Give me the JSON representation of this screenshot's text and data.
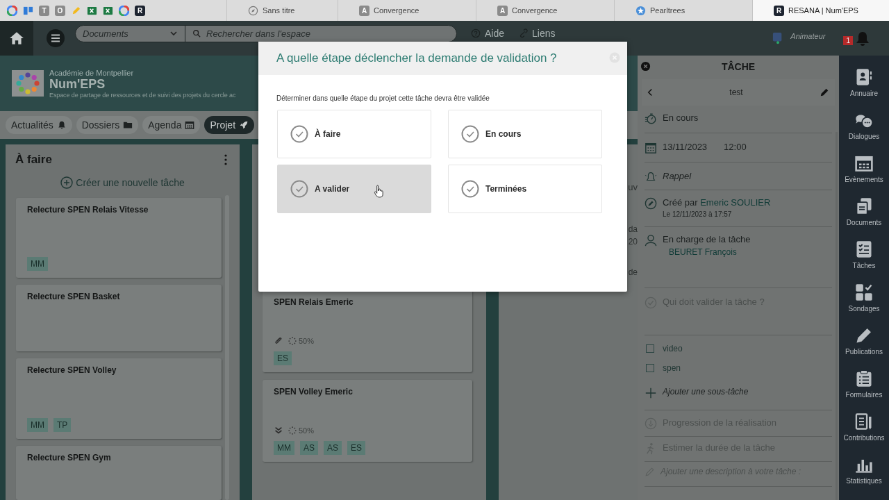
{
  "browser": {
    "shortcuts": [
      {
        "kind": "google"
      },
      {
        "kind": "board"
      },
      {
        "kind": "letter",
        "letter": "T"
      },
      {
        "kind": "letter",
        "letter": "O"
      },
      {
        "kind": "pencil"
      },
      {
        "kind": "sheet"
      },
      {
        "kind": "sheet"
      },
      {
        "kind": "google"
      },
      {
        "kind": "dark-letter",
        "letter": "R"
      }
    ],
    "tabs": [
      {
        "title": "Sans titre",
        "kind": "compass",
        "selected": false
      },
      {
        "title": "Convergence",
        "kind": "letter",
        "letter": "A",
        "selected": false
      },
      {
        "title": "Convergence",
        "kind": "letter",
        "letter": "A",
        "selected": false
      },
      {
        "title": "Pearltrees",
        "kind": "star",
        "selected": false
      },
      {
        "title": "RESANA | Num'EPS",
        "kind": "dark-letter",
        "letter": "R",
        "selected": true
      }
    ]
  },
  "toolbar": {
    "space_select": "Documents",
    "search": {
      "placeholder": "Rechercher dans l'espace"
    },
    "links": [
      {
        "label": "Aide",
        "kind": "help"
      },
      {
        "label": "Liens",
        "kind": "link"
      }
    ],
    "role": "Animateur",
    "notifications": "1"
  },
  "space": {
    "academy": "Académie de Montpellier",
    "name": "Num'EPS",
    "description": "Espace de partage de ressources et de suivi des projets du cercle ac"
  },
  "nav": [
    {
      "label": "Actualités",
      "kind": "bell",
      "selected": false
    },
    {
      "label": "Dossiers",
      "kind": "folder",
      "selected": false
    },
    {
      "label": "Agenda",
      "kind": "calendar",
      "selected": false
    },
    {
      "label": "Projet",
      "kind": "rocket",
      "selected": true
    }
  ],
  "board": {
    "columns": [
      {
        "title": "À faire",
        "create_label": "Créer une nouvelle tâche",
        "cards": [
          {
            "title": "Relecture SPEN Relais Vitesse",
            "tags": [
              "MM"
            ]
          },
          {
            "title": "Relecture SPEN Basket"
          },
          {
            "title": "Relecture SPEN Volley",
            "tags": [
              "MM",
              "TP"
            ]
          },
          {
            "title": "Relecture SPEN Gym"
          }
        ]
      },
      {
        "cards": [
          {
            "title": "SPEN Relais Emeric",
            "kind": "attachment",
            "progress": "50%",
            "tags": [
              "ES"
            ]
          },
          {
            "title": "SPEN Volley Emeric",
            "kind": "low-priority",
            "progress": "50%",
            "tags": [
              "MM",
              "AS",
              "AS",
              "ES"
            ]
          }
        ]
      },
      {
        "fragments": [
          "uv",
          "da",
          "20",
          "de"
        ]
      }
    ]
  },
  "modal": {
    "title": "A quelle étape déclencher la demande de validation ?",
    "instruction": "Déterminer dans quelle étape du projet cette tâche devra être validée",
    "steps": [
      {
        "label": "À faire",
        "highlighted": false
      },
      {
        "label": "En cours",
        "highlighted": false
      },
      {
        "label": "A valider",
        "highlighted": true
      },
      {
        "label": "Terminées",
        "highlighted": false
      }
    ]
  },
  "panel": {
    "title": "TÂCHE",
    "task_name": "test",
    "rows": [
      {
        "kind": "status",
        "text": "En cours"
      },
      {
        "kind": "date",
        "date": "13/11/2023",
        "time": "12:00"
      },
      {
        "kind": "reminder",
        "text": "Rappel"
      },
      {
        "kind": "author",
        "prefix": "Créé par",
        "name": "Emeric SOULIER",
        "date": "Le 12/11/2023 à 17:57"
      },
      {
        "kind": "assignee",
        "text": "En charge de la tâche",
        "name": "BEURET François"
      },
      {
        "kind": "validator",
        "text": "Qui doit valider la tâche ?"
      },
      {
        "kind": "checklist",
        "items": [
          {
            "label": "video",
            "checked": false
          },
          {
            "label": "spen",
            "checked": false
          }
        ]
      },
      {
        "kind": "add",
        "text": "Ajouter une sous-tâche"
      },
      {
        "kind": "progress",
        "text": "Progression de la réalisation"
      },
      {
        "kind": "estimate",
        "text": "Estimer la durée de la tâche"
      },
      {
        "kind": "description",
        "text": "Ajouter une description à votre tâche :"
      }
    ]
  },
  "sidebar": [
    {
      "label": "Annuaire",
      "kind": "contacts"
    },
    {
      "label": "Dialogues",
      "kind": "chat"
    },
    {
      "label": "Evènements",
      "kind": "calendar"
    },
    {
      "label": "Documents",
      "kind": "documents"
    },
    {
      "label": "Tâches",
      "kind": "checklist"
    },
    {
      "label": "Sondages",
      "kind": "grid"
    },
    {
      "label": "Publications",
      "kind": "pencil"
    },
    {
      "label": "Formulaires",
      "kind": "clipboard"
    },
    {
      "label": "Contributions",
      "kind": "book"
    },
    {
      "label": "Statistiques",
      "kind": "chart"
    }
  ]
}
